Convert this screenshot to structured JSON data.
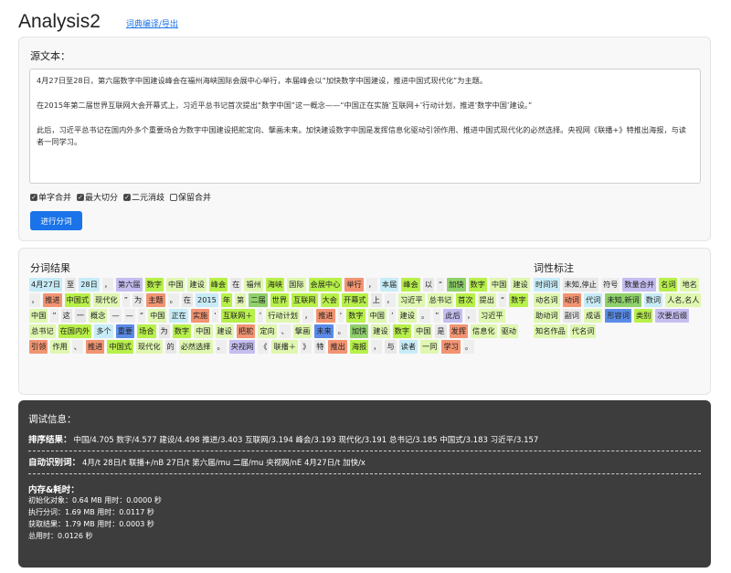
{
  "header": {
    "title": "Analysis2",
    "dict_link": "词典编译/导出"
  },
  "source": {
    "label": "源文本：",
    "paragraphs": [
      "4月27日至28日，第六届数字中国建设峰会在福州海峡国际会展中心举行，本届峰会以“加快数字中国建设，推进中国式现代化”为主题。",
      "在2015年第二届世界互联网大会开幕式上，习近平总书记首次提出“数字中国”这一概念——“中国正在实施‘互联网+’行动计划，推进‘数字中国’建设。”",
      "此后，习近平总书记在国内外多个重要场合为数字中国建设把舵定向、擘画未来。加快建设数字中国是发挥信息化驱动引领作用、推进中国式现代化的必然选择。央视网《联播+》特推出海报，与读者一同学习。"
    ],
    "options": [
      {
        "label": "单字合并",
        "checked": true
      },
      {
        "label": "最大切分",
        "checked": true
      },
      {
        "label": "二元消歧",
        "checked": true
      },
      {
        "label": "保留合并",
        "checked": false
      }
    ],
    "run_button": "进行分词"
  },
  "results": {
    "label": "分词结果",
    "tokens": [
      {
        "t": "4月27日",
        "c": "#c8ecf7"
      },
      {
        "t": "至",
        "c": "#e8e8e8"
      },
      {
        "t": "28日",
        "c": "#c8ecf7"
      },
      {
        "t": "，",
        "c": "#eeeeee"
      },
      {
        "t": "第六届",
        "c": "#c5bef0"
      },
      {
        "t": "数字",
        "c": "#b8f04a"
      },
      {
        "t": "中国",
        "c": "#dff7b0"
      },
      {
        "t": "建设",
        "c": "#dff7b0"
      },
      {
        "t": "峰会",
        "c": "#b8f04a"
      },
      {
        "t": "在",
        "c": "#e8e8e8"
      },
      {
        "t": "福州",
        "c": "#dff7b0"
      },
      {
        "t": "海峡",
        "c": "#b8f04a"
      },
      {
        "t": "国际",
        "c": "#dff7b0"
      },
      {
        "t": "会展中心",
        "c": "#b8f04a"
      },
      {
        "t": "举行",
        "c": "#f29472"
      },
      {
        "t": "，",
        "c": "#eeeeee"
      },
      {
        "t": "本届",
        "c": "#c8ecf7"
      },
      {
        "t": "峰会",
        "c": "#b8f04a"
      },
      {
        "t": "以",
        "c": "#e8e8e8"
      },
      {
        "t": "“",
        "c": "#eeeeee"
      },
      {
        "t": "加快",
        "c": "#8fd16a"
      },
      {
        "t": "数字",
        "c": "#b8f04a"
      },
      {
        "t": "中国",
        "c": "#dff7b0"
      },
      {
        "t": "建设",
        "c": "#dff7b0"
      },
      {
        "t": "，",
        "c": "#eeeeee"
      },
      {
        "t": "推进",
        "c": "#f29472"
      },
      {
        "t": "中国式",
        "c": "#b8f04a"
      },
      {
        "t": "现代化",
        "c": "#dff7b0"
      },
      {
        "t": "”",
        "c": "#eeeeee"
      },
      {
        "t": "为",
        "c": "#e8e8e8"
      },
      {
        "t": "主题",
        "c": "#f29472"
      },
      {
        "t": "。",
        "c": "#eeeeee"
      },
      {
        "t": "在",
        "c": "#e8e8e8"
      },
      {
        "t": "2015",
        "c": "#c8ecf7"
      },
      {
        "t": "年",
        "c": "#b8f04a"
      },
      {
        "t": "第",
        "c": "#dff7b0"
      },
      {
        "t": "二届",
        "c": "#8fd16a"
      },
      {
        "t": "世界",
        "c": "#b8f04a"
      },
      {
        "t": "互联网",
        "c": "#b8f04a"
      },
      {
        "t": "大会",
        "c": "#b8f04a"
      },
      {
        "t": "开幕式",
        "c": "#b8f04a"
      },
      {
        "t": "上",
        "c": "#e8e8e8"
      },
      {
        "t": "，",
        "c": "#eeeeee"
      },
      {
        "t": "习近平",
        "c": "#dff7b0"
      },
      {
        "t": "总书记",
        "c": "#dff7b0"
      },
      {
        "t": "首次",
        "c": "#b8f04a"
      },
      {
        "t": "提出",
        "c": "#dff7b0"
      },
      {
        "t": "“",
        "c": "#eeeeee"
      },
      {
        "t": "数字",
        "c": "#b8f04a"
      },
      {
        "t": "中国",
        "c": "#dff7b0"
      },
      {
        "t": "”",
        "c": "#eeeeee"
      },
      {
        "t": "这",
        "c": "#e8e8e8"
      },
      {
        "t": "一",
        "c": "#e8e8e8"
      },
      {
        "t": "概念",
        "c": "#dff7b0"
      },
      {
        "t": "—",
        "c": "#eeeeee"
      },
      {
        "t": "—",
        "c": "#eeeeee"
      },
      {
        "t": "“",
        "c": "#eeeeee"
      },
      {
        "t": "中国",
        "c": "#dff7b0"
      },
      {
        "t": "正在",
        "c": "#c8ecf7"
      },
      {
        "t": "实施",
        "c": "#f29472"
      },
      {
        "t": "‘",
        "c": "#eeeeee"
      },
      {
        "t": "互联网＋",
        "c": "#b8f04a"
      },
      {
        "t": "’",
        "c": "#eeeeee"
      },
      {
        "t": "行动计划",
        "c": "#dff7b0"
      },
      {
        "t": "，",
        "c": "#eeeeee"
      },
      {
        "t": "推进",
        "c": "#f29472"
      },
      {
        "t": "‘",
        "c": "#eeeeee"
      },
      {
        "t": "数字",
        "c": "#b8f04a"
      },
      {
        "t": "中国",
        "c": "#dff7b0"
      },
      {
        "t": "’",
        "c": "#eeeeee"
      },
      {
        "t": "建设",
        "c": "#dff7b0"
      },
      {
        "t": "。",
        "c": "#eeeeee"
      },
      {
        "t": "”",
        "c": "#eeeeee"
      },
      {
        "t": "此后",
        "c": "#c5bef0"
      },
      {
        "t": "，",
        "c": "#eeeeee"
      },
      {
        "t": "习近平",
        "c": "#dff7b0"
      },
      {
        "t": "总书记",
        "c": "#dff7b0"
      },
      {
        "t": "在国内外",
        "c": "#b8f04a"
      },
      {
        "t": "多个",
        "c": "#c8ecf7"
      },
      {
        "t": "重要",
        "c": "#5a8be8"
      },
      {
        "t": "场合",
        "c": "#b8f04a"
      },
      {
        "t": "为",
        "c": "#e8e8e8"
      },
      {
        "t": "数字",
        "c": "#b8f04a"
      },
      {
        "t": "中国",
        "c": "#dff7b0"
      },
      {
        "t": "建设",
        "c": "#dff7b0"
      },
      {
        "t": "把舵",
        "c": "#f29472"
      },
      {
        "t": "定向",
        "c": "#dff7b0"
      },
      {
        "t": "、",
        "c": "#eeeeee"
      },
      {
        "t": "擘画",
        "c": "#dff7b0"
      },
      {
        "t": "未来",
        "c": "#5a8be8"
      },
      {
        "t": "。",
        "c": "#eeeeee"
      },
      {
        "t": "加快",
        "c": "#8fd16a"
      },
      {
        "t": "建设",
        "c": "#dff7b0"
      },
      {
        "t": "数字",
        "c": "#b8f04a"
      },
      {
        "t": "中国",
        "c": "#dff7b0"
      },
      {
        "t": "是",
        "c": "#e8e8e8"
      },
      {
        "t": "发挥",
        "c": "#f29472"
      },
      {
        "t": "信息化",
        "c": "#dff7b0"
      },
      {
        "t": "驱动",
        "c": "#dff7b0"
      },
      {
        "t": "引领",
        "c": "#f29472"
      },
      {
        "t": "作用",
        "c": "#dff7b0"
      },
      {
        "t": "、",
        "c": "#eeeeee"
      },
      {
        "t": "推进",
        "c": "#f29472"
      },
      {
        "t": "中国式",
        "c": "#b8f04a"
      },
      {
        "t": "现代化",
        "c": "#dff7b0"
      },
      {
        "t": "的",
        "c": "#e8e8e8"
      },
      {
        "t": "必然选择",
        "c": "#dff7b0"
      },
      {
        "t": "。",
        "c": "#eeeeee"
      },
      {
        "t": "央视网",
        "c": "#c5bef0"
      },
      {
        "t": "《",
        "c": "#eeeeee"
      },
      {
        "t": "联播＋",
        "c": "#dff7b0"
      },
      {
        "t": "》",
        "c": "#eeeeee"
      },
      {
        "t": "特",
        "c": "#e8e8e8"
      },
      {
        "t": "推出",
        "c": "#f29472"
      },
      {
        "t": "海报",
        "c": "#b8f04a"
      },
      {
        "t": "，",
        "c": "#eeeeee"
      },
      {
        "t": "与",
        "c": "#e8e8e8"
      },
      {
        "t": "读者",
        "c": "#c8ecf7"
      },
      {
        "t": "一同",
        "c": "#dff7b0"
      },
      {
        "t": "学习",
        "c": "#f29472"
      },
      {
        "t": "。",
        "c": "#eeeeee"
      }
    ]
  },
  "pos": {
    "label": "词性标注",
    "tags": [
      {
        "t": "时间词",
        "c": "#c8ecf7"
      },
      {
        "t": "未知,停止",
        "c": "#e8e8e8"
      },
      {
        "t": "符号",
        "c": "#eeeeee"
      },
      {
        "t": "数量合并",
        "c": "#c5bef0"
      },
      {
        "t": "名词",
        "c": "#b8f04a"
      },
      {
        "t": "地名",
        "c": "#dff7b0"
      },
      {
        "t": "动名词",
        "c": "#dff7b0"
      },
      {
        "t": "动词",
        "c": "#f29472"
      },
      {
        "t": "代词",
        "c": "#c8ecf7"
      },
      {
        "t": "未知,新词",
        "c": "#8fd16a"
      },
      {
        "t": "数词",
        "c": "#c8ecf7"
      },
      {
        "t": "人名,名人",
        "c": "#dff7b0"
      },
      {
        "t": "助动词",
        "c": "#dff7b0"
      },
      {
        "t": "副词",
        "c": "#e8e8e8"
      },
      {
        "t": "成语",
        "c": "#dff7b0"
      },
      {
        "t": "形容词",
        "c": "#5a8be8"
      },
      {
        "t": "类别",
        "c": "#b8f04a"
      },
      {
        "t": "次要后缀",
        "c": "#c5bef0"
      },
      {
        "t": "知名作品",
        "c": "#dff7b0"
      },
      {
        "t": "代名词",
        "c": "#dff7b0"
      }
    ]
  },
  "debug": {
    "title": "调试信息：",
    "rank_label": "排序结果：",
    "rank_text": "中国/4.705 数字/4.577 建设/4.498 推进/3.403 互联网/3.194 峰会/3.193 现代化/3.191 总书记/3.185 中国式/3.183 习近平/3.157",
    "auto_label": "自动识别词：",
    "auto_text": "4月/t 28日/t 联播+/nB 27日/t 第六届/mu 二届/mu 央视网/nE 4月27日/t 加快/x",
    "mem_title": "内存&耗时：",
    "mem_lines": [
      "初始化对象：0.64 MB 用时：0.0000 秒",
      "执行分词：1.69 MB 用时：0.0117 秒",
      "获取结果：1.79 MB 用时：0.0003 秒",
      "总用时：0.0126 秒"
    ]
  }
}
